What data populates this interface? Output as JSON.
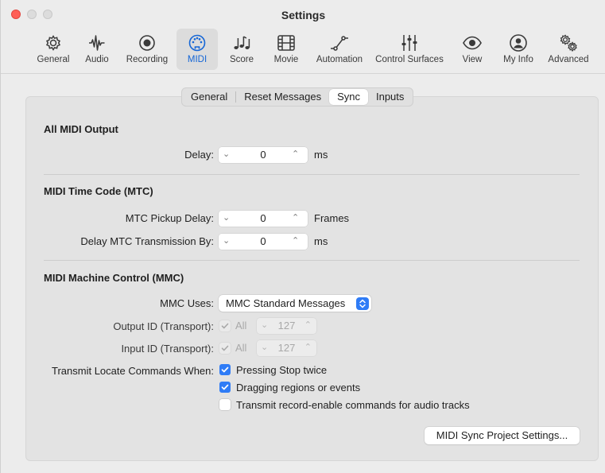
{
  "window": {
    "title": "Settings"
  },
  "toolbar": {
    "items": [
      {
        "label": "General",
        "icon": "gear-icon"
      },
      {
        "label": "Audio",
        "icon": "waveform-icon"
      },
      {
        "label": "Recording",
        "icon": "record-icon"
      },
      {
        "label": "MIDI",
        "icon": "midi-port-icon",
        "active": true
      },
      {
        "label": "Score",
        "icon": "music-notes-icon"
      },
      {
        "label": "Movie",
        "icon": "film-icon"
      },
      {
        "label": "Automation",
        "icon": "automation-curve-icon"
      },
      {
        "label": "Control Surfaces",
        "icon": "sliders-icon"
      },
      {
        "label": "View",
        "icon": "eye-icon"
      },
      {
        "label": "My Info",
        "icon": "person-icon"
      },
      {
        "label": "Advanced",
        "icon": "gears-icon"
      }
    ]
  },
  "tabs": [
    "General",
    "Reset Messages",
    "Sync",
    "Inputs"
  ],
  "active_tab": "Sync",
  "all_midi_output": {
    "heading": "All MIDI Output",
    "delay_label": "Delay:",
    "delay_value": "0",
    "delay_unit": "ms"
  },
  "mtc": {
    "heading": "MIDI Time Code (MTC)",
    "pickup_label": "MTC Pickup Delay:",
    "pickup_value": "0",
    "pickup_unit": "Frames",
    "transmission_label": "Delay MTC Transmission By:",
    "transmission_value": "0",
    "transmission_unit": "ms"
  },
  "mmc": {
    "heading": "MIDI Machine Control (MMC)",
    "uses_label": "MMC Uses:",
    "uses_value": "MMC Standard Messages",
    "output_id_label": "Output ID (Transport):",
    "output_all_label": "All",
    "output_id_value": "127",
    "input_id_label": "Input ID (Transport):",
    "input_all_label": "All",
    "input_id_value": "127",
    "transmit_label": "Transmit Locate Commands When:",
    "options": [
      {
        "label": "Pressing Stop twice",
        "checked": true
      },
      {
        "label": "Dragging regions or events",
        "checked": true
      },
      {
        "label": "Transmit record-enable commands for audio tracks",
        "checked": false
      }
    ]
  },
  "sync_button": "MIDI Sync Project Settings...",
  "colors": {
    "accent": "#2f7cf6",
    "active_toolbar_text": "#1566d6",
    "close_button": "#ff5f57"
  }
}
